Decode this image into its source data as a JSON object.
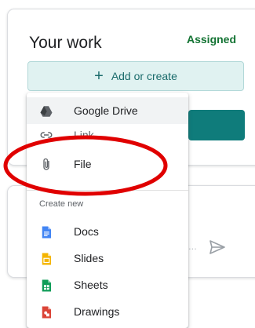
{
  "card": {
    "title": "Your work",
    "status": "Assigned",
    "add_button_label": "Add or create"
  },
  "menu": {
    "items": [
      {
        "label": "Google Drive",
        "icon": "google-drive-icon"
      },
      {
        "label": "Link",
        "icon": "link-icon"
      },
      {
        "label": "File",
        "icon": "paperclip-icon"
      }
    ],
    "create_new_label": "Create new",
    "create_items": [
      {
        "label": "Docs",
        "icon": "google-docs-icon",
        "color": "#4285f4"
      },
      {
        "label": "Slides",
        "icon": "google-slides-icon",
        "color": "#f4b400"
      },
      {
        "label": "Sheets",
        "icon": "google-sheets-icon",
        "color": "#0f9d58"
      },
      {
        "label": "Drawings",
        "icon": "google-drawings-icon",
        "color": "#db4437"
      }
    ]
  },
  "comment": {
    "placeholder": "..."
  },
  "colors": {
    "accent": "#0f7c7b",
    "status": "#137333",
    "annotation": "#e00000"
  }
}
